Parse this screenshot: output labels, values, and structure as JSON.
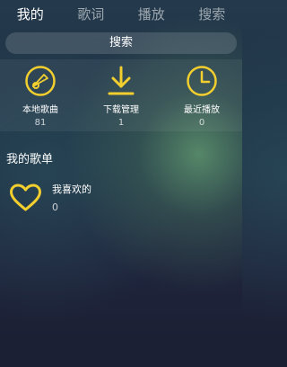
{
  "tabs": [
    {
      "label": "我的",
      "active": true
    },
    {
      "label": "歌词",
      "active": false
    },
    {
      "label": "播放",
      "active": false
    },
    {
      "label": "搜索",
      "active": false
    }
  ],
  "search": {
    "label": "搜索"
  },
  "quick_access": [
    {
      "label": "本地歌曲",
      "count": "81",
      "icon": "disc-icon"
    },
    {
      "label": "下载管理",
      "count": "1",
      "icon": "download-icon"
    },
    {
      "label": "最近播放",
      "count": "0",
      "icon": "clock-icon"
    }
  ],
  "my_playlists": {
    "title": "我的歌单",
    "items": [
      {
        "name": "我喜欢的",
        "count": "0",
        "icon": "heart-icon"
      }
    ]
  },
  "colors": {
    "accent": "#f2cf2e",
    "text": "#ffffff"
  }
}
